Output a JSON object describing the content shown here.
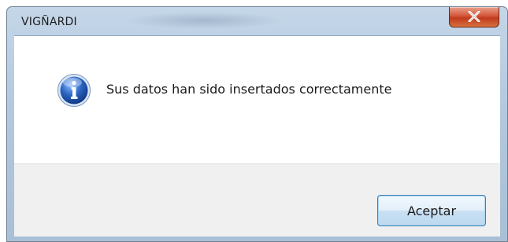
{
  "window": {
    "title": "VIGÑARDI",
    "close_icon": "close-icon"
  },
  "message": {
    "icon": "info-icon",
    "text": "Sus datos han sido insertados correctamente"
  },
  "footer": {
    "ok_label": "Aceptar"
  },
  "colors": {
    "titlebar": "#b9cde2",
    "close_button": "#c9442a",
    "content_bg": "#ffffff",
    "footer_bg": "#f0f0f0",
    "button_border": "#3c7fb1",
    "info_icon": "#2a63c0"
  }
}
